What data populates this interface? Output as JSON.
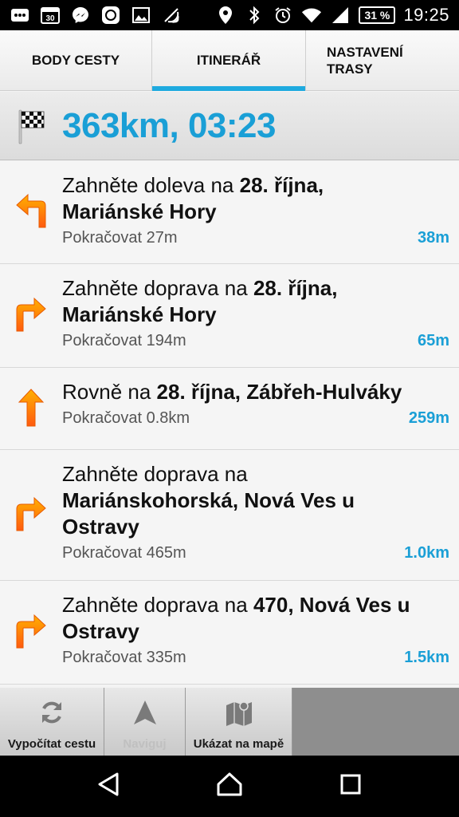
{
  "status_bar": {
    "calendar_day": "30",
    "battery": "31 %",
    "time": "19:25",
    "icons": [
      "grid-dots-icon",
      "calendar-icon",
      "messenger-icon",
      "app-icon",
      "image-icon",
      "nfc-icon",
      "location-icon",
      "bluetooth-icon",
      "alarm-icon",
      "wifi-icon",
      "signal-icon",
      "battery-icon"
    ]
  },
  "tabs": [
    {
      "label": "BODY CESTY",
      "active": false
    },
    {
      "label": "ITINERÁŘ",
      "active": true
    },
    {
      "label_line1": "NASTAVENÍ",
      "label_line2": "TRASY",
      "active": false
    }
  ],
  "summary": {
    "icon": "checkered-flag-icon",
    "text": "363km, 03:23"
  },
  "steps": [
    {
      "arrow": "turn-left-arrow-icon",
      "prefix": "Zahněte doleva na ",
      "road": "28. října,",
      "road2": "Mariánské Hory",
      "continue": "Pokračovat 27m",
      "distance": "38m"
    },
    {
      "arrow": "turn-right-arrow-icon",
      "prefix": "Zahněte doprava na ",
      "road": "28. října,",
      "road2": "Mariánské Hory",
      "continue": "Pokračovat 194m",
      "distance": "65m"
    },
    {
      "arrow": "straight-arrow-icon",
      "prefix": "Rovně na ",
      "road": "28. října, Zábřeh-Hulváky",
      "road2": "",
      "continue": "Pokračovat 0.8km",
      "distance": "259m"
    },
    {
      "arrow": "turn-right-arrow-icon",
      "prefix": "Zahněte doprava na",
      "road": "Mariánskohorská, Nová Ves u",
      "road2": "Ostravy",
      "continue": "Pokračovat 465m",
      "distance": "1.0km"
    },
    {
      "arrow": "turn-right-arrow-icon",
      "prefix": "Zahněte doprava na ",
      "road": "470, Nová Ves u",
      "road2": "Ostravy",
      "continue": "Pokračovat 335m",
      "distance": "1.5km"
    }
  ],
  "toolbar": {
    "recalculate_label": "Vypočítat cestu",
    "navigate_label": "Naviguj",
    "show_on_map_label": "Ukázat na mapě"
  },
  "colors": {
    "accent": "#1a9fd6",
    "arrow_orange": "#ff7a12"
  }
}
